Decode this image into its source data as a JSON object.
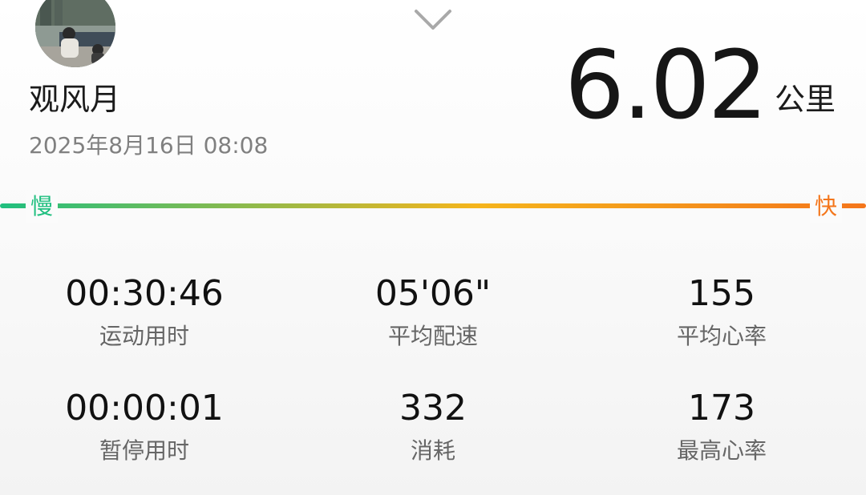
{
  "profile": {
    "name": "观风月"
  },
  "run": {
    "datetime": "2025年8月16日 08:08",
    "distance": "6.02",
    "distance_unit": "公里"
  },
  "pace_scale": {
    "slow_label": "慢",
    "fast_label": "快",
    "slow_color": "#1fbf7f",
    "mid_color": "#f5b51c",
    "fast_color": "#f4761b"
  },
  "stats": [
    {
      "value": "00:30:46",
      "label": "运动用时"
    },
    {
      "value": "05'06\"",
      "label": "平均配速"
    },
    {
      "value": "155",
      "label": "平均心率"
    },
    {
      "value": "00:00:01",
      "label": "暂停用时"
    },
    {
      "value": "332",
      "label": "消耗"
    },
    {
      "value": "173",
      "label": "最高心率"
    }
  ],
  "icons": {
    "collapse": "chevron-down-icon"
  }
}
